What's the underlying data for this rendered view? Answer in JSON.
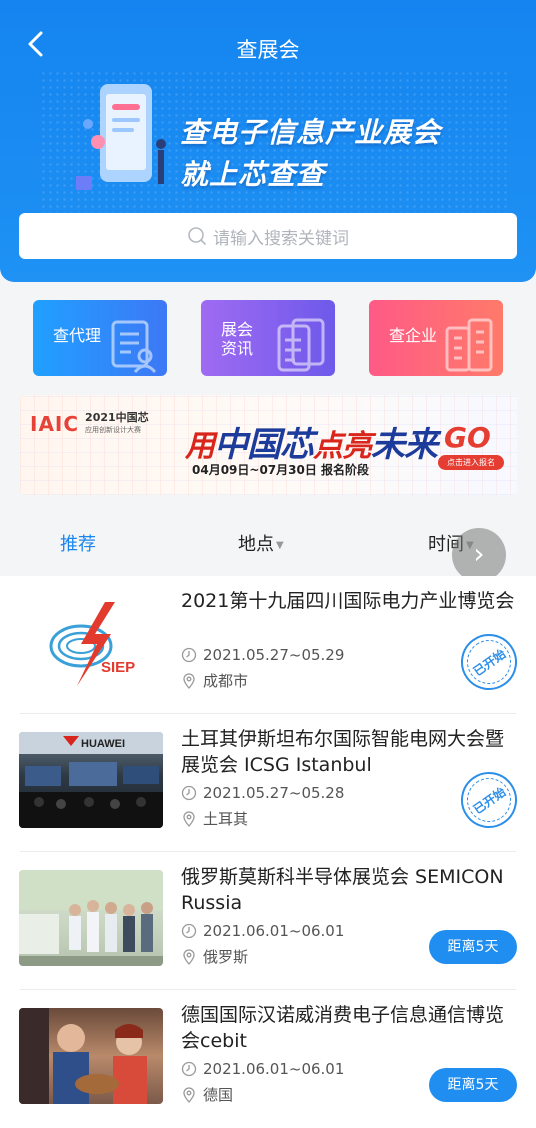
{
  "header": {
    "title": "查展会",
    "banner_line1": "查电子信息产业展会",
    "banner_line2": "就上芯查查"
  },
  "search": {
    "placeholder": "请输入搜索关键词"
  },
  "quick_links": [
    {
      "label": "查代理"
    },
    {
      "label_line1": "展会",
      "label_line2": "资讯"
    },
    {
      "label": "查企业"
    }
  ],
  "ad": {
    "logo_mark": "IAIC",
    "logo_title": "2021中国芯",
    "logo_sub": "应用创新设计大赛",
    "slogan_red1": "用",
    "slogan_blue1": "中国芯",
    "slogan_red2": "点亮",
    "slogan_blue2": "未来",
    "date": "04月09日~07月30日  报名阶段",
    "go": "GO",
    "go_sub": "点击进入报名"
  },
  "tabs": [
    {
      "label": "推荐",
      "active": true
    },
    {
      "label": "地点"
    },
    {
      "label": "时间"
    }
  ],
  "events": [
    {
      "title": "2021第十九届四川国际电力产业博览会",
      "date": "2021.05.27~05.29",
      "location": "成都市",
      "status": "已开始",
      "thumb_logo": "SIEP"
    },
    {
      "title": "土耳其伊斯坦布尔国际智能电网大会暨展览会 ICSG Istanbul",
      "date": "2021.05.27~05.28",
      "location": "土耳其",
      "status": "已开始",
      "thumb_logo": "HUAWEI"
    },
    {
      "title": "俄罗斯莫斯科半导体展览会 SEMICON Russia",
      "date": "2021.06.01~06.01",
      "location": "俄罗斯",
      "status": "距离5天"
    },
    {
      "title": "德国国际汉诺威消费电子信息通信博览会cebit",
      "date": "2021.06.01~06.01",
      "location": "德国",
      "status": "距离5天"
    }
  ],
  "colors": {
    "primary": "#1a86ef",
    "accent_red": "#e53d32"
  }
}
